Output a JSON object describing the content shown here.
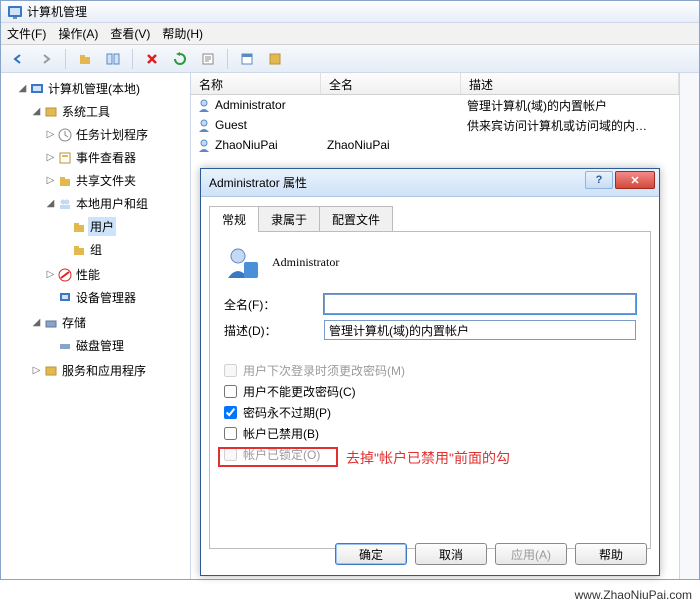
{
  "window": {
    "title": "计算机管理"
  },
  "menu": {
    "file": "文件(F)",
    "action": "操作(A)",
    "view": "查看(V)",
    "help": "帮助(H)"
  },
  "tree": {
    "root": "计算机管理(本地)",
    "system_tools": "系统工具",
    "task_scheduler": "任务计划程序",
    "event_viewer": "事件查看器",
    "shared_folders": "共享文件夹",
    "local_users": "本地用户和组",
    "users": "用户",
    "groups": "组",
    "performance": "性能",
    "device_manager": "设备管理器",
    "storage": "存储",
    "disk_management": "磁盘管理",
    "services_apps": "服务和应用程序"
  },
  "list": {
    "col_name": "名称",
    "col_fullname": "全名",
    "col_desc": "描述",
    "rows": [
      {
        "name": "Administrator",
        "fullname": "",
        "desc": "管理计算机(域)的内置帐户"
      },
      {
        "name": "Guest",
        "fullname": "",
        "desc": "供来宾访问计算机或访问域的内…"
      },
      {
        "name": "ZhaoNiuPai",
        "fullname": "ZhaoNiuPai",
        "desc": ""
      }
    ]
  },
  "dialog": {
    "title": "Administrator 属性",
    "tabs": {
      "general": "常规",
      "memberof": "隶属于",
      "profile": "配置文件"
    },
    "username": "Administrator",
    "fullname_label": "全名(F)：",
    "fullname_value": "",
    "desc_label": "描述(D)：",
    "desc_value": "管理计算机(域)的内置帐户",
    "chk_must_change": "用户下次登录时须更改密码(M)",
    "chk_cannot_change": "用户不能更改密码(C)",
    "chk_never_expire": "密码永不过期(P)",
    "chk_disabled": "帐户已禁用(B)",
    "chk_locked": "帐户已锁定(O)",
    "buttons": {
      "ok": "确定",
      "cancel": "取消",
      "apply": "应用(A)",
      "help": "帮助"
    }
  },
  "annotation": {
    "note": "去掉\"帐户已禁用\"前面的勾"
  },
  "watermark": "www.ZhaoNiuPai.com"
}
